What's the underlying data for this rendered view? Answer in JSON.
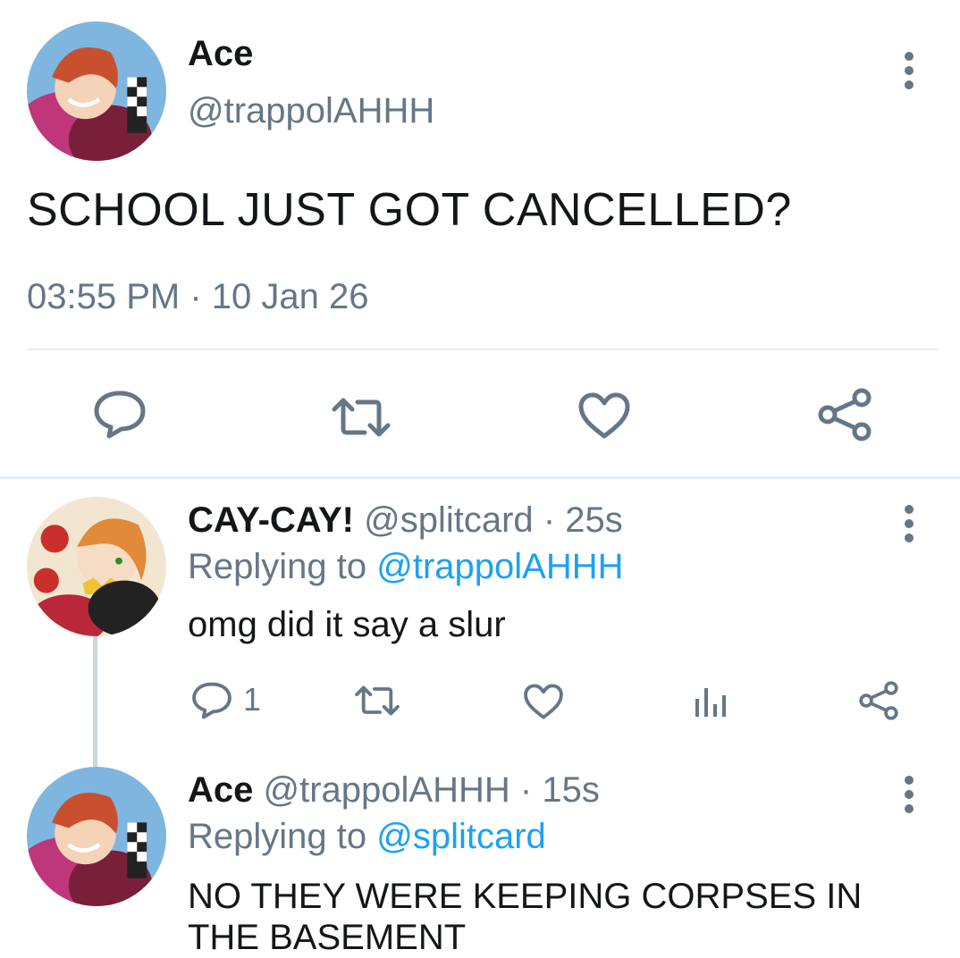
{
  "main_tweet": {
    "author_name": "Ace",
    "author_handle": "@trappolAHHH",
    "text": "SCHOOL JUST GOT CANCELLED?",
    "time": "03:55 PM",
    "separator": "·",
    "date": "10 Jan 26",
    "actions": {
      "reply_icon": "reply-icon",
      "retweet_icon": "retweet-icon",
      "like_icon": "heart-icon",
      "share_icon": "share-icon"
    }
  },
  "replies": [
    {
      "author_name": "CAY-CAY!",
      "author_handle": "@splitcard",
      "age": "· 25s",
      "replying_label": "Replying to",
      "replying_to": "@trappolAHHH",
      "text": "omg did it say a slur",
      "reply_count": "1"
    },
    {
      "author_name": "Ace",
      "author_handle": "@trappolAHHH",
      "age": "· 15s",
      "replying_label": "Replying to",
      "replying_to": "@splitcard",
      "text": "NO THEY WERE KEEPING CORPSES IN THE BASEMENT"
    }
  ],
  "colors": {
    "text": "#14171a",
    "muted": "#657786",
    "link": "#1da1f2",
    "divider": "#e6ecf0"
  }
}
